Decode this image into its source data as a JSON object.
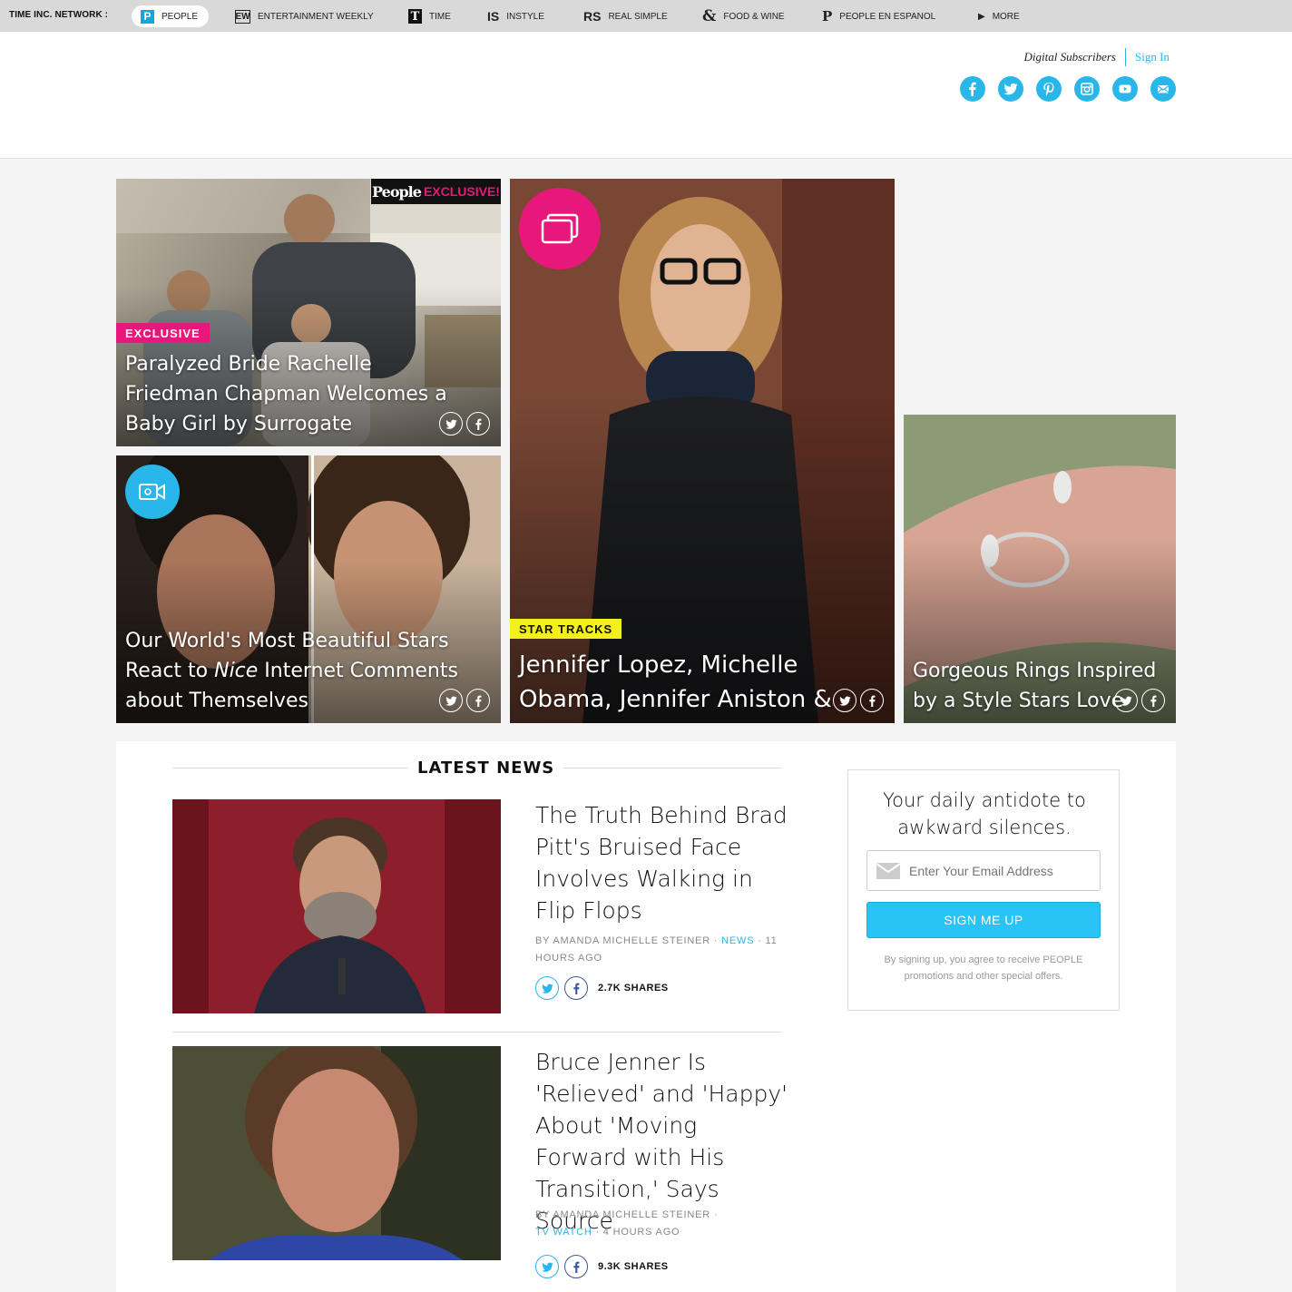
{
  "network": {
    "label": "TIME INC. NETWORK :",
    "items": [
      {
        "logo": "P",
        "label": "PEOPLE"
      },
      {
        "logo": "EW",
        "label": "ENTERTAINMENT WEEKLY"
      },
      {
        "logo": "T",
        "label": "TIME"
      },
      {
        "logo": "IS",
        "label": "INSTYLE"
      },
      {
        "logo": "RS",
        "label": "REAL SIMPLE"
      },
      {
        "logo": "&",
        "label": "FOOD & WINE"
      },
      {
        "logo": "P",
        "label": "PEOPLE EN ESPANOL"
      },
      {
        "logo": "▶",
        "label": "MORE"
      }
    ]
  },
  "header": {
    "subscribers": "Digital Subscribers",
    "sign_in": "Sign In",
    "social_icons": [
      "facebook-icon",
      "twitter-icon",
      "pinterest-icon",
      "instagram-icon",
      "youtube-icon",
      "email-icon"
    ]
  },
  "hero": {
    "exclusive_badge": {
      "brand": "People",
      "text": "EXCLUSIVE!"
    },
    "tiles": [
      {
        "tag": "EXCLUSIVE",
        "headline": "Paralyzed Bride Rachelle Friedman Chapman Welcomes a Baby Girl by Surrogate"
      },
      {
        "tag": "",
        "headline_pre": "Our World's Most Beautiful Stars React to ",
        "headline_em": "Nice",
        "headline_post": " Internet Comments about Themselves"
      },
      {
        "tag": "STAR TRACKS",
        "headline": "Jennifer Lopez, Michelle Obama, Jennifer Aniston & More!"
      },
      {
        "tag": "",
        "headline": "Gorgeous Rings Inspired by a Style Stars Love"
      }
    ]
  },
  "latest_news": {
    "title": "LATEST NEWS",
    "stories": [
      {
        "headline": "The Truth Behind Brad Pitt's Bruised Face Involves Walking in Flip Flops",
        "byline": "BY AMANDA MICHELLE STEINER ·",
        "category": "NEWS",
        "time": "· 11 HOURS AGO",
        "shares": "2.7K SHARES"
      },
      {
        "headline": "Bruce Jenner Is 'Relieved' and 'Happy' About 'Moving Forward with His Transition,' Says Source",
        "byline": "BY AMANDA MICHELLE STEINER ·",
        "category": "TV WATCH",
        "time": "· 4 HOURS AGO",
        "shares": "9.3K SHARES"
      }
    ]
  },
  "newsletter": {
    "title": "Your daily antidote to awkward silences.",
    "placeholder": "Enter Your Email Address",
    "button": "SIGN ME UP",
    "legal": "By signing up, you agree to receive PEOPLE promotions and other special offers."
  },
  "colors": {
    "accent": "#29b6e8",
    "pink": "#e8177c",
    "yellow": "#f3f01c"
  }
}
